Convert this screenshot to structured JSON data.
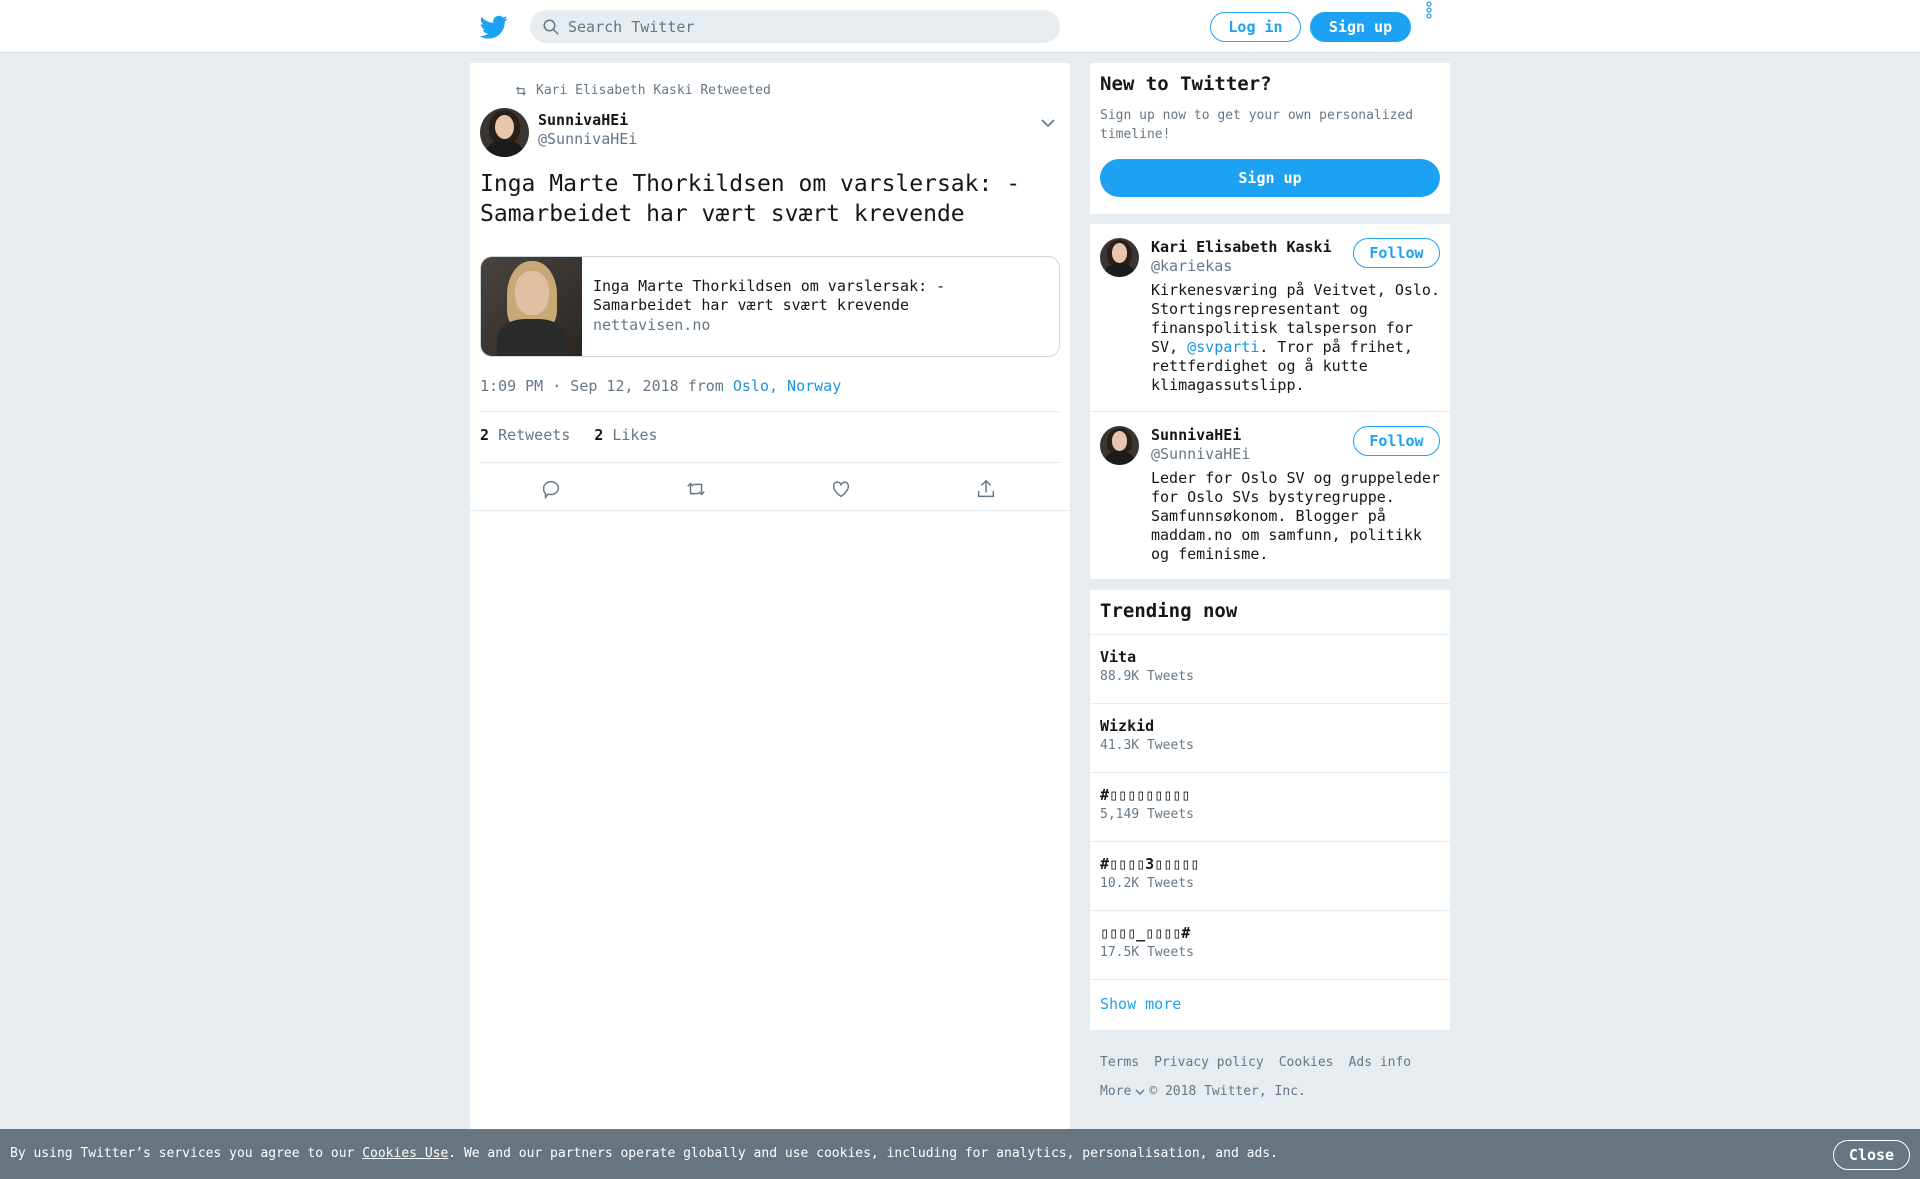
{
  "header": {
    "search_placeholder": "Search Twitter",
    "login_label": "Log in",
    "signup_label": "Sign up"
  },
  "tweet": {
    "retweet_context": "Kari Elisabeth Kaski Retweeted",
    "author_name": "SunnivaHEi",
    "author_handle": "@SunnivaHEi",
    "text": "Inga Marte Thorkildsen om varslersak: - Samarbeidet har vært svært krevende",
    "card": {
      "title": "Inga Marte Thorkildsen om varslersak: - Samarbeidet har vært svært krevende",
      "domain": "nettavisen.no"
    },
    "timestamp": "1:09 PM · Sep 12, 2018 from",
    "location": "Oslo, Norway",
    "retweets_count": "2",
    "retweets_label": "Retweets",
    "likes_count": "2",
    "likes_label": "Likes"
  },
  "sidebar": {
    "new_title": "New to Twitter?",
    "new_desc": "Sign up now to get your own personalized timeline!",
    "signup_label": "Sign up",
    "users": [
      {
        "name": "Kari Elisabeth Kaski",
        "handle": "@kariekas",
        "follow_label": "Follow",
        "bio_before": "Kirkenesværing på Veitvet, Oslo. Stortingsrepresentant og finanspolitisk talsperson for SV, ",
        "bio_link": "@svparti",
        "bio_after": ". Tror på frihet, rettferdighet og å kutte klimagassutslipp."
      },
      {
        "name": "SunnivaHEi",
        "handle": "@SunnivaHEi",
        "follow_label": "Follow",
        "bio": "Leder for Oslo SV og gruppeleder for Oslo SVs bystyregruppe. Samfunnsøkonom. Blogger på maddam.no om samfunn, politikk og feminisme."
      }
    ],
    "trending_title": "Trending now",
    "trends": [
      {
        "name": "Vita",
        "count": "88.9K Tweets"
      },
      {
        "name": "Wizkid",
        "count": "41.3K Tweets"
      },
      {
        "name": "#▯▯▯▯▯▯▯▯▯",
        "count": "5,149 Tweets"
      },
      {
        "name": "#▯▯▯▯3▯▯▯▯▯",
        "count": "10.2K Tweets"
      },
      {
        "name": "▯▯▯▯_▯▯▯▯#",
        "count": "17.5K Tweets"
      }
    ],
    "show_more": "Show more"
  },
  "footer": {
    "links": [
      "Terms",
      "Privacy policy",
      "Cookies",
      "Ads info"
    ],
    "more_label": "More",
    "copyright": "© 2018 Twitter, Inc."
  },
  "cookie": {
    "text_before": "By using Twitter’s services you agree to our ",
    "link": "Cookies Use",
    "text_after": ". We and our partners operate globally and use cookies, including for analytics, personalisation, and ads.",
    "close_label": "Close"
  },
  "colors": {
    "brand": "#1da1f2",
    "link": "#1b95e0",
    "secondary_text": "#657786",
    "background": "#e6ecf0"
  }
}
